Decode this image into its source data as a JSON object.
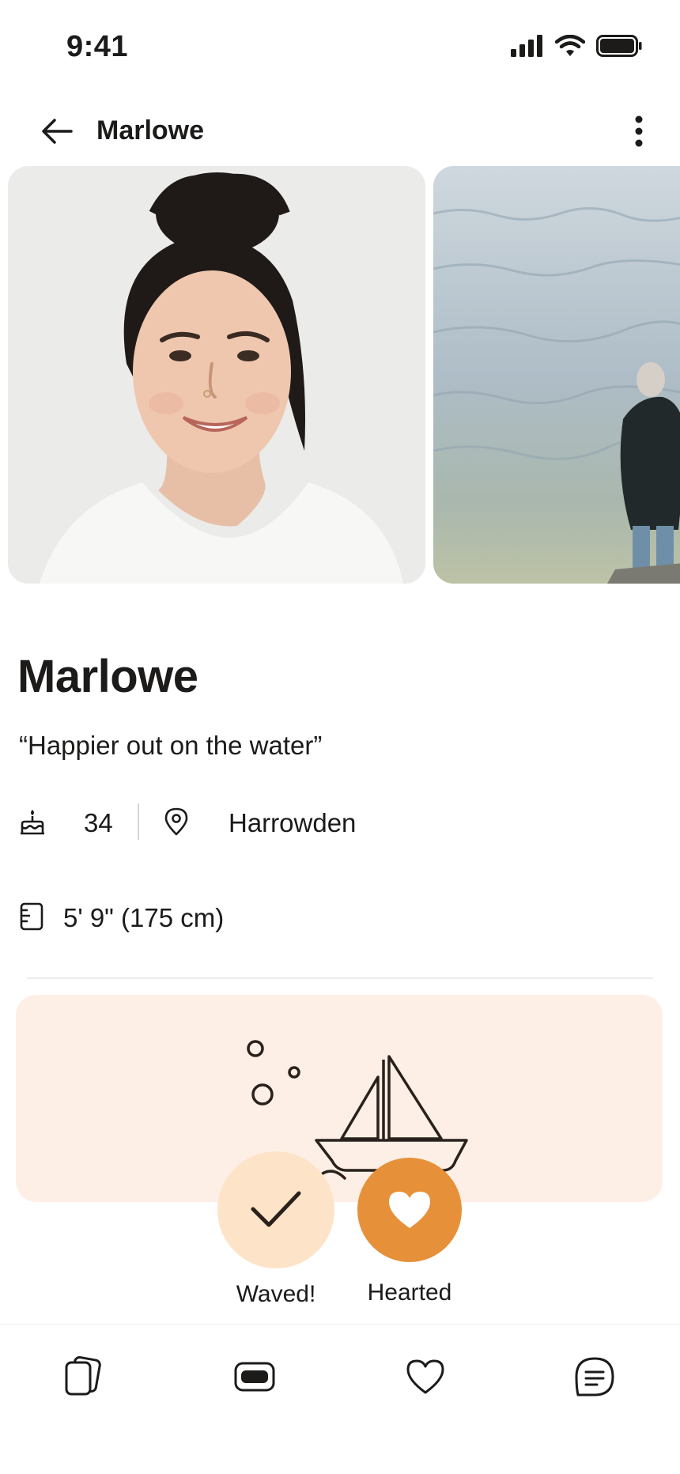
{
  "status_bar": {
    "time": "9:41"
  },
  "header": {
    "title": "Marlowe"
  },
  "gallery": {
    "photos": [
      {
        "alt": "Portrait of Marlowe smiling"
      },
      {
        "alt": "Person standing by the water"
      }
    ]
  },
  "profile": {
    "name": "Marlowe",
    "tagline": "“Happier out on the water”",
    "age": "34",
    "location": "Harrowden",
    "height": "5' 9\" (175 cm)"
  },
  "actions": {
    "waved_label": "Waved!",
    "hearted_label": "Hearted"
  },
  "colors": {
    "accent": "#e6913a",
    "waved_bg": "#fde4c8",
    "card_bg": "#fdefe5"
  },
  "nav": {
    "items": [
      {
        "icon": "cards-icon"
      },
      {
        "icon": "standouts-icon"
      },
      {
        "icon": "heart-icon"
      },
      {
        "icon": "chat-icon"
      }
    ]
  }
}
